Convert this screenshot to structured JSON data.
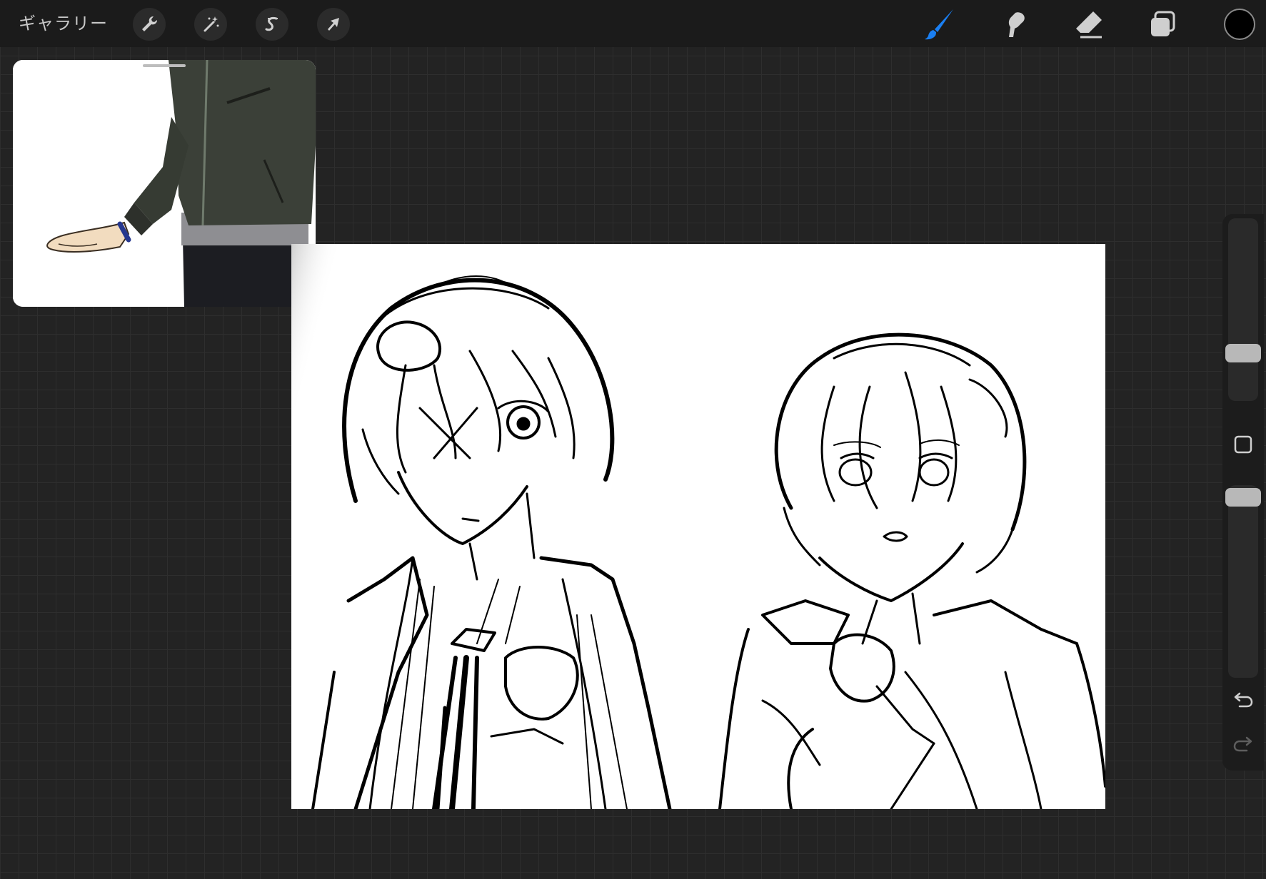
{
  "topbar": {
    "gallery_label": "ギャラリー",
    "tools_left": [
      "wrench-icon",
      "magic-wand-icon",
      "selection-icon",
      "transform-arrow-icon"
    ],
    "tools_right": [
      "brush-icon",
      "smudge-icon",
      "eraser-icon",
      "layers-icon"
    ],
    "active_tool": "brush",
    "accent_color": "#1a7ff2",
    "current_color": "#000000"
  },
  "reference_window": {
    "content": "reference-image-jacket-arm"
  },
  "canvas": {
    "content": "sketch-two-characters"
  },
  "sidebar": {
    "brush_size": 0.75,
    "opacity": 0.75,
    "buttons": [
      "modify-square-icon",
      "undo-icon",
      "redo-icon"
    ]
  }
}
